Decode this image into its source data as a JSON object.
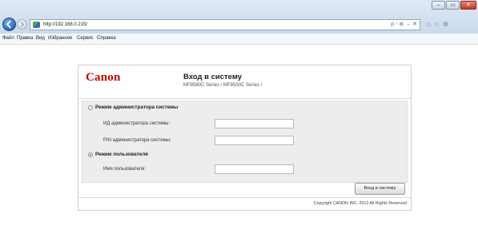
{
  "browser": {
    "url": "http://192.168.0.215/",
    "address_tools": "ρ - ≣ → ✕",
    "right_tools": "⌂☆⚙",
    "window_controls": {
      "minimize": "–",
      "maximize": "▭",
      "close": "✕"
    },
    "icons": {
      "back": "back-arrow-icon",
      "forward": "forward-arrow-icon",
      "favicon": "site-favicon-icon"
    }
  },
  "menu": [
    "Файл",
    "Правка",
    "Вид",
    "Избранное",
    "Сервис",
    "Справка"
  ],
  "login": {
    "logo": "Canon",
    "title": "Вход в систему",
    "subtitle": "MF8580C Series / MF8550C Series /",
    "admin_mode": {
      "label": "Режим администратора системы",
      "selected": false
    },
    "admin_id_label": "ИД администратора системы:",
    "admin_pin_label": "PIN администратора системы:",
    "user_mode": {
      "label": "Режим пользователя",
      "selected": true
    },
    "username_label": "Имя пользователя:",
    "admin_id_value": "",
    "admin_pin_value": "",
    "username_value": "",
    "login_button": "Вход в систему",
    "copyright": "Copyright CANON INC. 2013 All Rights Reserved"
  },
  "colors": {
    "brand": "#cc0000",
    "chrome": "#c9d9ec",
    "panel": "#ededed"
  }
}
